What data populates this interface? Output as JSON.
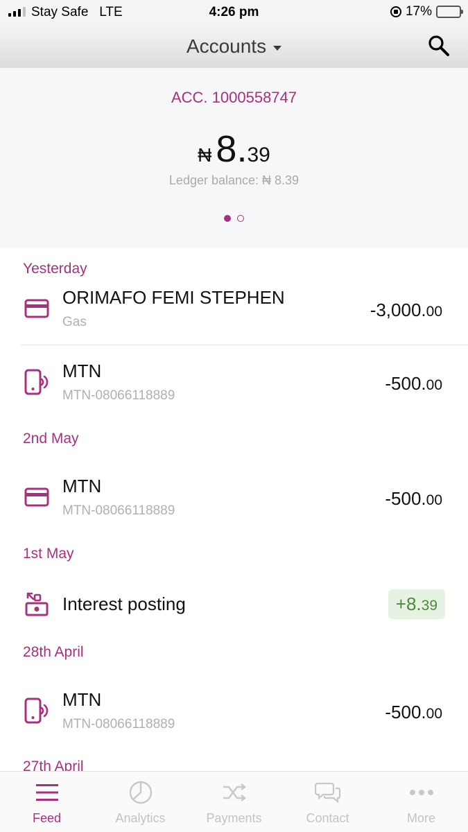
{
  "status_bar": {
    "carrier": "Stay Safe",
    "network": "LTE",
    "time": "4:26 pm",
    "battery": "17%",
    "battery_level": 0.17,
    "battery_color": "#f2c40f"
  },
  "header": {
    "title": "Accounts",
    "search_icon": "search-icon",
    "dropdown_icon": "chevron-down-icon"
  },
  "balance_card": {
    "account_number": "ACC. 1000558747",
    "currency_symbol": "₦",
    "balance_whole": "8.",
    "balance_decimal": "39",
    "ledger_balance": "Ledger balance: ₦ 8.39",
    "pager": {
      "current": 1,
      "total": 2
    }
  },
  "feed": {
    "groups": [
      {
        "label": "Yesterday",
        "transactions": [
          {
            "icon": "card-icon",
            "title": "ORIMAFO FEMI STEPHEN",
            "subtitle": "Gas",
            "amount_whole": "-3,000.",
            "amount_decimal": "00",
            "type": "debit"
          },
          {
            "icon": "mobile-airtime-icon",
            "title": "MTN",
            "subtitle": "MTN-08066118889",
            "amount_whole": "-500.",
            "amount_decimal": "00",
            "type": "debit"
          }
        ]
      },
      {
        "label": "2nd May",
        "transactions": [
          {
            "icon": "card-icon",
            "title": "MTN",
            "subtitle": "MTN-08066118889",
            "amount_whole": "-500.",
            "amount_decimal": "00",
            "type": "debit"
          }
        ]
      },
      {
        "label": "1st May",
        "transactions": [
          {
            "icon": "interest-icon",
            "title": "Interest posting",
            "subtitle": "",
            "amount_whole": "+8.",
            "amount_decimal": "39",
            "type": "credit"
          }
        ]
      },
      {
        "label": "28th April",
        "transactions": [
          {
            "icon": "mobile-airtime-icon",
            "title": "MTN",
            "subtitle": "MTN-08066118889",
            "amount_whole": "-500.",
            "amount_decimal": "00",
            "type": "debit"
          }
        ]
      },
      {
        "label": "27th April",
        "transactions": []
      }
    ]
  },
  "tab_bar": {
    "tabs": [
      {
        "label": "Feed",
        "icon": "menu-icon",
        "active": true
      },
      {
        "label": "Analytics",
        "icon": "pie-chart-icon",
        "active": false
      },
      {
        "label": "Payments",
        "icon": "shuffle-icon",
        "active": false
      },
      {
        "label": "Contact",
        "icon": "chat-icon",
        "active": false
      },
      {
        "label": "More",
        "icon": "more-icon",
        "active": false
      }
    ]
  },
  "colors": {
    "brand": "#a7307f",
    "credit_text": "#4b8b3b",
    "credit_bg": "#e6f3e3",
    "muted": "#b0b0b0"
  }
}
